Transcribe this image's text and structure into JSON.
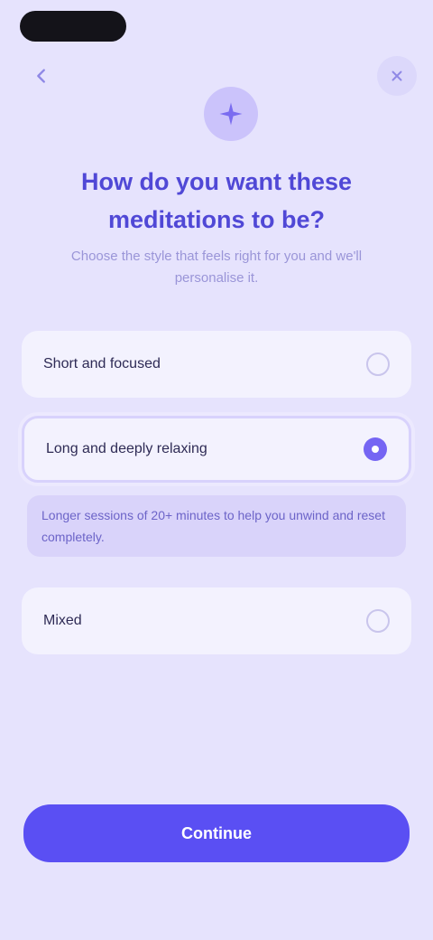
{
  "header": {
    "back_icon": "arrow-left-icon",
    "close_icon": "close-icon",
    "hero_icon": "sparkle-icon"
  },
  "question": {
    "title": "How do you want these meditations to be?",
    "subtitle": "Choose the style that feels right for you and we'll personalise it."
  },
  "options": [
    {
      "label": "Short and focused",
      "selected": false
    },
    {
      "label": "Long and deeply relaxing",
      "selected": true
    },
    {
      "label": "Mixed",
      "selected": false
    }
  ],
  "helper": {
    "text": "Longer sessions of 20+ minutes to help you unwind and reset completely."
  },
  "footer": {
    "continue_label": "Continue"
  },
  "colors": {
    "background": "#e6e3fd",
    "accent": "#5a4ff3",
    "title": "#5048d6"
  }
}
